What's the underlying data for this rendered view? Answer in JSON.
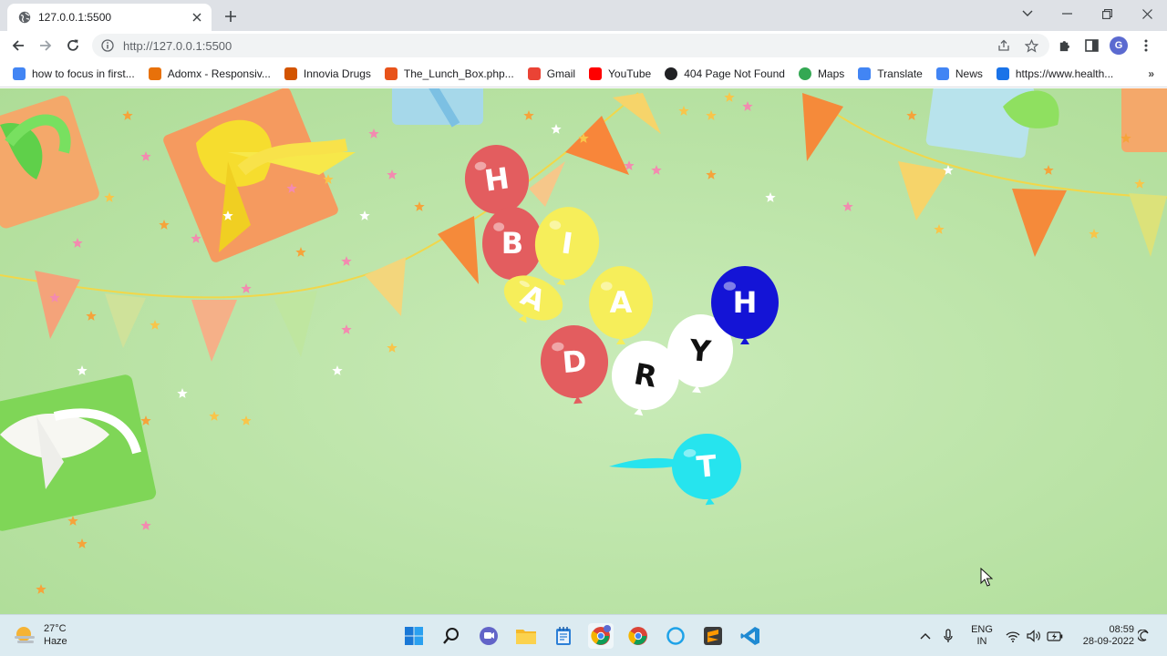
{
  "browser": {
    "tab": {
      "title": "127.0.0.1:5500"
    },
    "address_bar": {
      "url": "http://127.0.0.1:5500"
    },
    "profile_initial": "G",
    "bookmarks": [
      {
        "label": "how to focus in first...",
        "icon": "google-icon",
        "color": "#4285f4"
      },
      {
        "label": "Adomx - Responsiv...",
        "icon": "h-logo-icon",
        "color": "#e8710a"
      },
      {
        "label": "Innovia Drugs",
        "icon": "innovia-icon",
        "color": "#d35400"
      },
      {
        "label": "The_Lunch_Box.php...",
        "icon": "lunchbox-icon",
        "color": "#e8531a"
      },
      {
        "label": "Gmail",
        "icon": "gmail-icon",
        "color": "#ea4335"
      },
      {
        "label": "YouTube",
        "icon": "youtube-icon",
        "color": "#ff0000"
      },
      {
        "label": "404 Page Not Found",
        "icon": "globe-icon",
        "color": "#202124"
      },
      {
        "label": "Maps",
        "icon": "maps-icon",
        "color": "#34a853"
      },
      {
        "label": "Translate",
        "icon": "translate-icon",
        "color": "#4285f4"
      },
      {
        "label": "News",
        "icon": "news-icon",
        "color": "#4285f4"
      },
      {
        "label": "https://www.health...",
        "icon": "health-icon",
        "color": "#1a73e8"
      }
    ]
  },
  "page": {
    "balloons": [
      {
        "letter": "H",
        "color": "#e35d5f"
      },
      {
        "letter": "B",
        "color": "#e35d5f"
      },
      {
        "letter": "I",
        "color": "#f6ee5a"
      },
      {
        "letter": "A",
        "color": "#f6ee5a"
      },
      {
        "letter": "A",
        "color": "#f6ee5a"
      },
      {
        "letter": "D",
        "color": "#e35d5f"
      },
      {
        "letter": "R",
        "color": "#ffffff"
      },
      {
        "letter": "Y",
        "color": "#ffffff"
      },
      {
        "letter": "H",
        "color": "#1414d6"
      },
      {
        "letter": "T",
        "color": "#26e4ee"
      }
    ]
  },
  "taskbar": {
    "weather": {
      "temperature": "27°C",
      "condition": "Haze"
    },
    "language": {
      "line1": "ENG",
      "line2": "IN"
    },
    "clock": {
      "time": "08:59",
      "date": "28-09-2022"
    },
    "pinned_apps": [
      "start-icon",
      "search-icon",
      "teams-icon",
      "file-explorer-icon",
      "notepad-icon",
      "chrome-profile-icon",
      "chrome-icon",
      "cortana-icon",
      "sublime-text-icon",
      "vscode-icon"
    ]
  }
}
